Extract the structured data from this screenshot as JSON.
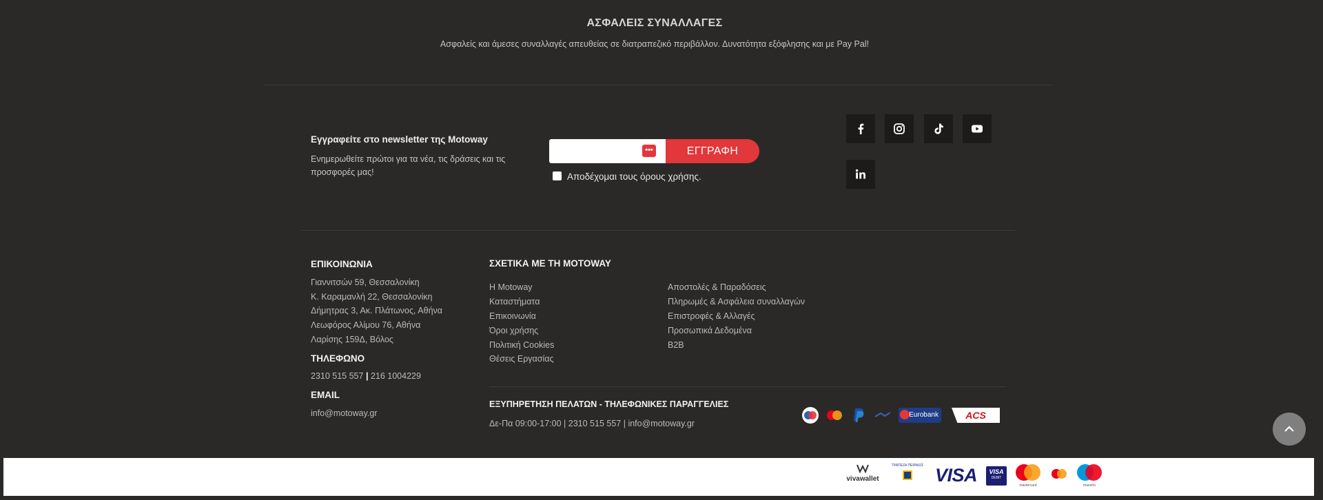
{
  "secure": {
    "title": "ΑΣΦΑΛΕΙΣ ΣΥΝΑΛΛΑΓΕΣ",
    "text": "Ασφαλείς και άμεσες συναλλαγές απευθείας σε διατραπεζικό περιβάλλον. Δυνατότητα εξόφλησης και με Pay Pal!"
  },
  "newsletter": {
    "title": "Εγγραφείτε στο newsletter της Motoway",
    "text": "Ενημερωθείτε πρώτοι για τα νέα, τις δράσεις και τις προσφορές μας!",
    "input_value": "",
    "dots": "•••",
    "button": "ΕΓΓΡΑΦΗ",
    "terms": "Αποδέχομαι τους όρους χρήσης."
  },
  "social": [
    "facebook-icon",
    "instagram-icon",
    "tiktok-icon",
    "youtube-icon",
    "linkedin-icon"
  ],
  "contact": {
    "title": "ΕΠΙΚΟΙΝΩΝΙΑ",
    "addresses": [
      "Γιαννιτσών 59, Θεσσαλονίκη",
      "Κ. Καραμανλή 22, Θεσσαλονίκη",
      "Δήμητρας 3, Ακ. Πλάτωνος, Αθήνα",
      "Λεωφόρος Αλίμου 76, Αθήνα",
      "Λαρίσης 159Δ, Βόλος"
    ],
    "phone_title": "ΤΗΛΕΦΩΝΟ",
    "phone1": "2310 515 557",
    "phone_sep": "|",
    "phone2": "216 1004229",
    "email_title": "EMAIL",
    "email": "info@motoway.gr"
  },
  "about": {
    "title": "ΣΧΕΤΙΚΑ ΜΕ ΤΗ MOTOWAY",
    "col1": [
      "Η Motoway",
      "Καταστήματα",
      "Επικοινωνία",
      "Όροι χρήσης",
      "Πολιτική Cookies",
      "Θέσεις Εργασίας"
    ],
    "col2": [
      "Αποστολές & Παραδόσεις",
      "Πληρωμές & Ασφάλεια συναλλαγών",
      "Επιστροφές & Αλλαγές",
      "Προσωπικά Δεδομένα",
      "B2B"
    ]
  },
  "service": {
    "title": "ΕΞΥΠΗΡΕΤΗΣΗ ΠΕΛΑΤΩΝ - ΤΗΛΕΦΩΝΙΚΕΣ ΠΑΡΑΓΓΕΛΙΕΣ",
    "hours": "Δε-Πα 09:00-17:00",
    "sep": "|",
    "phone": "2310 515 557",
    "email": "info@motoway.gr"
  },
  "logos_row1": {
    "eurobank": "Eurobank",
    "acs": "ACS"
  },
  "logos_row2": {
    "vivawallet": "vivawallet",
    "piraeus": "ΤΡΑΠΕΖΑ ΠΕΙΡΑΙΩΣ",
    "visa": "VISA",
    "visa_debit": "VISA",
    "visa_debit_sub": "DEBIT",
    "mastercard": "mastercard",
    "maestro": "maestro"
  },
  "colors": {
    "background": "#2a2927",
    "accent": "#e2373b"
  }
}
